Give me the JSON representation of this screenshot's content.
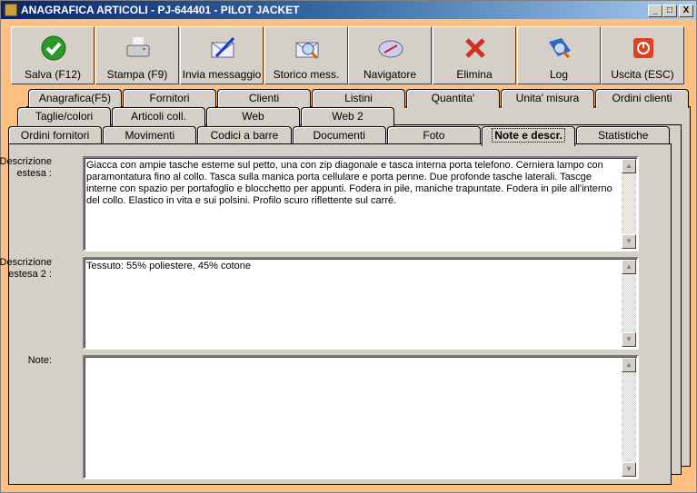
{
  "title": "ANAGRAFICA ARTICOLI - PJ-644401 - PILOT JACKET",
  "window_controls": {
    "minimize": "_",
    "maximize": "□",
    "close": "X"
  },
  "toolbar": [
    {
      "label": "Salva (F12)",
      "icon": "check-icon"
    },
    {
      "label": "Stampa (F9)",
      "icon": "printer-icon"
    },
    {
      "label": "Invia messaggio",
      "icon": "envelope-pen-icon"
    },
    {
      "label": "Storico mess.",
      "icon": "envelope-search-icon"
    },
    {
      "label": "Navigatore",
      "icon": "compass-icon"
    },
    {
      "label": "Elimina",
      "icon": "delete-x-icon"
    },
    {
      "label": "Log",
      "icon": "log-search-icon"
    },
    {
      "label": "Uscita (ESC)",
      "icon": "power-icon"
    }
  ],
  "tabs_row1": [
    "Anagrafica(F5)",
    "Fornitori",
    "Clienti",
    "Listini",
    "Quantita'",
    "Unita' misura",
    "Ordini clienti"
  ],
  "tabs_row2": [
    "Taglie/colori",
    "Articoli coll.",
    "Web",
    "Web 2"
  ],
  "tabs_row3": [
    "Ordini fornitori",
    "Movimenti",
    "Codici a barre",
    "Documenti",
    "Foto",
    "Note e descr.",
    "Statistiche"
  ],
  "active_tab": "Note e descr.",
  "fields": {
    "desc_label": "Descrizione estesa :",
    "desc_value": "Giacca con ampie tasche esterne sul petto, una con zip diagonale e tasca interna porta telefono. Cerniera lampo con paramontatura fino al collo. Tasca sulla manica porta cellulare e porta penne. Due profonde tasche laterali. Tascge interne con spazio per portafoglio e blocchetto per appunti. Fodera in pile, maniche trapuntate. Fodera in pile all'interno del collo. Elastico in vita e sui polsini. Profilo scuro riflettente sul carré.",
    "desc2_label": "Descrizione estesa 2 :",
    "desc2_value": "Tessuto: 55% poliestere, 45% cotone",
    "note_label": "Note:",
    "note_value": ""
  }
}
